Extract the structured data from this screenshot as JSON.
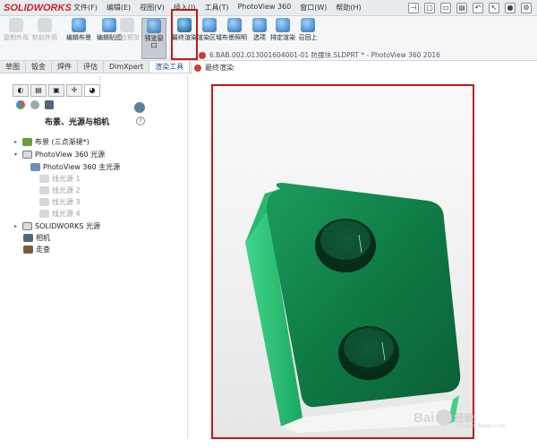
{
  "app": {
    "logo": "SOLIDWORKS",
    "menus": [
      "文件(F)",
      "编辑(E)",
      "视图(V)",
      "插入(I)",
      "工具(T)",
      "PhotoView 360",
      "窗口(W)",
      "帮助(H)"
    ]
  },
  "ribbon": {
    "buttons": [
      {
        "label": "复制外观",
        "enabled": false
      },
      {
        "label": "粘贴外观",
        "enabled": false
      },
      {
        "label": "编辑布景",
        "enabled": true
      },
      {
        "label": "编辑贴图",
        "enabled": true
      },
      {
        "label": "整合预览",
        "enabled": false
      },
      {
        "label": "预览窗口",
        "enabled": true
      },
      {
        "label": "最终渲染",
        "enabled": true
      },
      {
        "label": "渲染区域",
        "enabled": true
      },
      {
        "label": "布景照明",
        "enabled": true
      },
      {
        "label": "选项",
        "enabled": true
      },
      {
        "label": "排定渲染",
        "enabled": true
      },
      {
        "label": "召回上",
        "enabled": true
      }
    ]
  },
  "tabs": [
    "草图",
    "钣金",
    "焊件",
    "评估",
    "DimXpert",
    "渲染工具"
  ],
  "document": {
    "title": "6.BAB.002.013001604001-01 防撞块.SLDPRT * - PhotoView 360 2016",
    "breadcrumb": "最终渲染"
  },
  "panel": {
    "title": "布景、光源与相机",
    "help": "?",
    "tree": [
      {
        "label": "布景 (三点渐褪*)",
        "level": 0,
        "expander": "▸",
        "style": "normal"
      },
      {
        "label": "PhotoView 360 光源",
        "level": 0,
        "expander": "▾",
        "style": "normal"
      },
      {
        "label": "PhotoView 360 主光源",
        "level": 1,
        "expander": "",
        "style": "normal"
      },
      {
        "label": "线光源 1",
        "level": 1,
        "expander": "",
        "style": "light"
      },
      {
        "label": "线光源 2",
        "level": 1,
        "expander": "",
        "style": "light"
      },
      {
        "label": "线光源 3",
        "level": 1,
        "expander": "",
        "style": "light"
      },
      {
        "label": "线光源 4",
        "level": 1,
        "expander": "",
        "style": "light"
      },
      {
        "label": "SOLIDWORKS 光源",
        "level": 0,
        "expander": "▸",
        "style": "normal"
      },
      {
        "label": "相机",
        "level": 0,
        "expander": "",
        "style": "normal"
      },
      {
        "label": "走查",
        "level": 0,
        "expander": "",
        "style": "normal"
      }
    ]
  },
  "watermark": {
    "brand": "Bai",
    "brand_cn": "经验",
    "url": "jingyan.baidu.com"
  },
  "colors": {
    "highlight_box": "#c41a1a",
    "part_green": "#1fae6a",
    "part_dark": "#0f6b3e"
  }
}
